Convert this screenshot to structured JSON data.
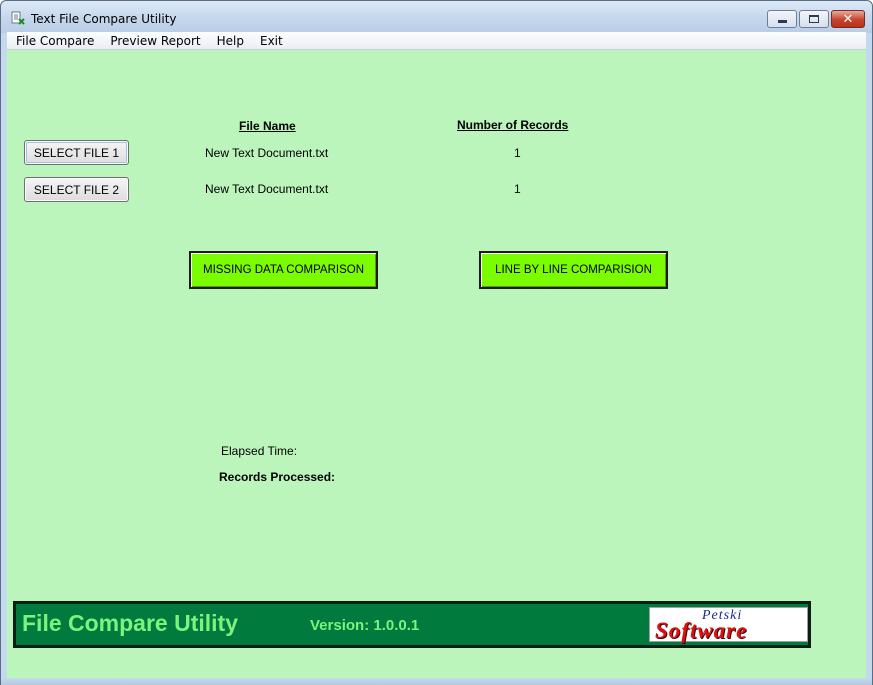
{
  "window": {
    "title": "Text File Compare Utility",
    "icon": "app-icon",
    "controls": {
      "minimize": "minimize-icon",
      "maximize": "maximize-icon",
      "close": "✕"
    }
  },
  "menu": {
    "items": [
      "File Compare",
      "Preview Report",
      "Help",
      "Exit"
    ]
  },
  "files": {
    "header_name": "File Name",
    "header_records": "Number of Records",
    "select1_label": "SELECT FILE 1",
    "select2_label": "SELECT FILE 2",
    "rows": [
      {
        "name": "New Text Document.txt",
        "records": "1"
      },
      {
        "name": "New Text Document.txt",
        "records": "1"
      }
    ]
  },
  "actions": {
    "missing_label": "MISSING DATA COMPARISON",
    "line_label": "LINE BY LINE COMPARISION"
  },
  "status": {
    "elapsed_label": "Elapsed Time:",
    "records_label": "Records Processed:"
  },
  "footer": {
    "title": "File Compare Utility",
    "version": "Version: 1.0.0.1",
    "logo_top": "Petski",
    "logo_main": "Software"
  },
  "colors": {
    "client_bg": "#bbf5bc",
    "action_button": "#7cfc00",
    "footer_bg": "#007a3d",
    "footer_text": "#7ef27e",
    "logo_red": "#e01010"
  }
}
